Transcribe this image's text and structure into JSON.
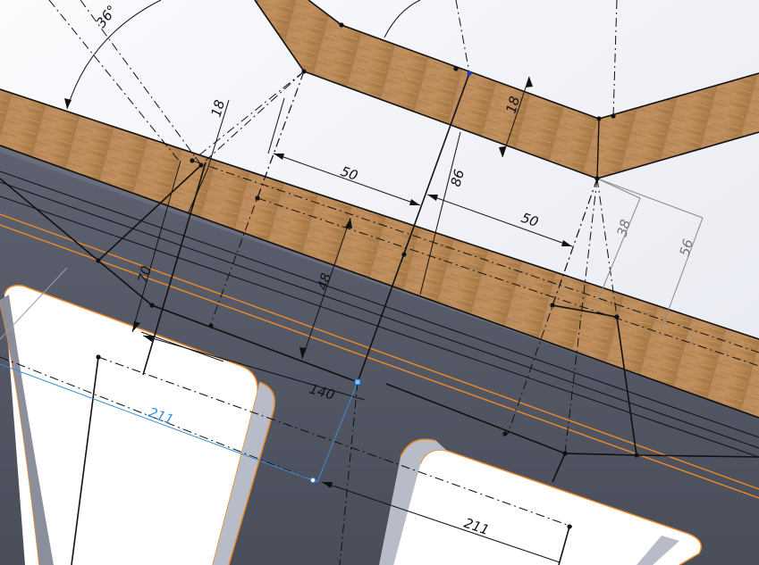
{
  "viewport": {
    "title": "",
    "colors": {
      "background": "#f4f5f9",
      "wood": "#b98c55",
      "wood_dark": "#9a6e3c",
      "sheet_metal": "#565a68",
      "sheet_metal_dark": "#474a57",
      "edge_orange": "#ee8a22",
      "sketch_line": "#111111",
      "selected_blue": "#3a8fd6",
      "reference_gray": "#8a8a8a"
    },
    "icons": {
      "sketch_point": "sketch-point-icon",
      "selected_point": "selected-point-icon"
    }
  },
  "dimensions": {
    "angle_top": "36°",
    "thickness_upper": "18",
    "thickness_left": "18",
    "offset_left": "50",
    "height_center": "86",
    "offset_right": "50",
    "depth_48": "48",
    "depth_70": "70",
    "ref_38": "38",
    "ref_56": "56",
    "length_140": "140",
    "selected_211": "211",
    "bottom_211": "211"
  }
}
